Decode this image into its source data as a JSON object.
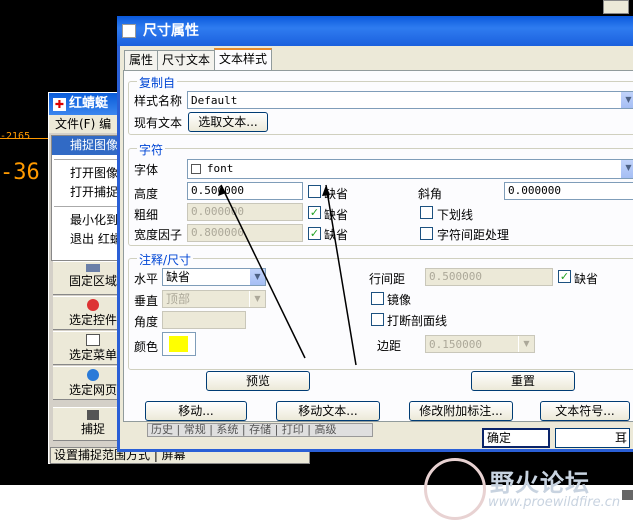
{
  "background_window": {
    "title": "红蜻蜓",
    "menubar": "文件(F)  编",
    "menu_items": [
      "捕捉图像",
      "打开图像",
      "打开捕捉",
      "最小化到",
      "退出 红蜻"
    ],
    "buttons": [
      "固定区域",
      "选定控件",
      "选定菜单",
      "选定网页",
      "捕捉"
    ],
    "status": "设置捕捉范围方式 | 屏幕"
  },
  "cad": {
    "left_text_1": "-2165",
    "left_text_2": "-36"
  },
  "dialog": {
    "title": "尺寸属性",
    "tabs": [
      "属性",
      "尺寸文本",
      "文本样式"
    ],
    "copy_from": {
      "group_title": "复制自",
      "style_name_label": "样式名称",
      "style_name_value": "Default",
      "existing_text_label": "现有文本",
      "select_text_button": "选取文本..."
    },
    "char": {
      "group_title": "字符",
      "font_label": "字体",
      "font_value": "font",
      "height_label": "高度",
      "height_value": "0.500000",
      "height_default_label": "缺省",
      "slant_label": "斜角",
      "slant_value": "0.000000",
      "thickness_label": "粗细",
      "thickness_value": "0.000000",
      "thickness_default_label": "缺省",
      "underline_label": "下划线",
      "width_factor_label": "宽度因子",
      "width_factor_value": "0.800000",
      "width_factor_default_label": "缺省",
      "kerning_label": "字符间距处理"
    },
    "note": {
      "group_title": "注释/尺寸",
      "horizontal_label": "水平",
      "horizontal_value": "缺省",
      "vertical_label": "垂直",
      "vertical_value": "顶部",
      "angle_label": "角度",
      "color_label": "颜色",
      "line_spacing_label": "行间距",
      "line_spacing_value": "0.500000",
      "line_spacing_default_label": "缺省",
      "mirror_label": "镜像",
      "break_hatch_label": "打断剖面线",
      "margin_label": "边距",
      "margin_value": "0.150000",
      "color_value": "#ffff00"
    },
    "preview_button": "预览",
    "reset_button": "重置",
    "bottom_buttons": [
      "移动...",
      "移动文本...",
      "修改附加标注...",
      "文本符号..."
    ],
    "bottom_strip": "历史 | 常规 | 系统 | 存储 | 打印 | 高级",
    "ok_button": "确定",
    "cancel_button_partial": "耳"
  },
  "watermark": {
    "text": "野火论坛",
    "url": "www.proewildfire.cn"
  }
}
